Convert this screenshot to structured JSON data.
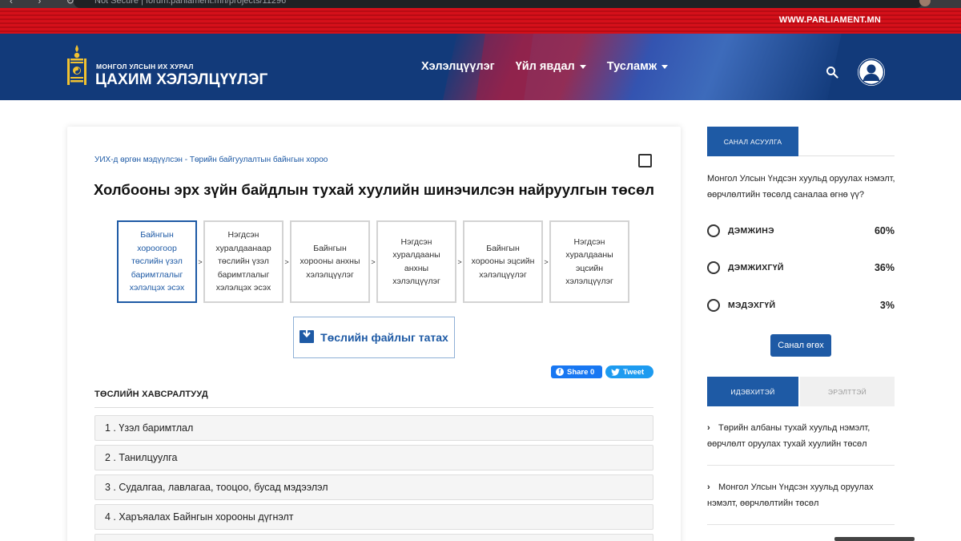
{
  "browser": {
    "url": "Not Secure | forum.parliament.mn/projects/11296"
  },
  "topbar": {
    "site_link": "WWW.PARLIAMENT.MN"
  },
  "header": {
    "logo_subtitle": "МОНГОЛ УЛСЫН ИХ ХУРАЛ",
    "logo_title": "ЦАХИМ ХЭЛЭЛЦҮҮЛЭГ",
    "menu": [
      {
        "label": "Хэлэлцүүлэг",
        "has_dropdown": false
      },
      {
        "label": "Үйл явдал",
        "has_dropdown": true
      },
      {
        "label": "Тусламж",
        "has_dropdown": true
      }
    ]
  },
  "main": {
    "breadcrumb": "УИХ-д өргөн мэдүүлсэн - Төрийн байгуулалтын байнгын хороо",
    "title": "Холбооны эрх зүйн байдлын тухай хуулийн шинэчилсэн найруулгын төсөл",
    "steps": [
      {
        "label": "Байнгын хороогоор төслийн үзэл баримтлалыг хэлэлцэх эсэх",
        "active": true
      },
      {
        "label": "Нэгдсэн хуралдаанаар төслийн үзэл баримтлалыг хэлэлцэх эсэх",
        "active": false
      },
      {
        "label": "Байнгын хорооны анхны хэлэлцүүлэг",
        "active": false
      },
      {
        "label": "Нэгдсэн хуралдааны анхны хэлэлцүүлэг",
        "active": false
      },
      {
        "label": "Байнгын хорооны эцсийн хэлэлцүүлэг",
        "active": false
      },
      {
        "label": "Нэгдсэн хуралдааны эцсийн хэлэлцүүлэг",
        "active": false
      }
    ],
    "step_separator": ">",
    "download_label": "Төслийн файлыг татах",
    "share": {
      "facebook_label": "Share 0",
      "twitter_label": "Tweet"
    },
    "attachments_heading": "ТӨСЛИЙН ХАВСРАЛТУУД",
    "attachments": [
      "1 . Үзэл баримтлал",
      "2 . Танилцуулга",
      "3 . Судалгаа, лавлагаа, тооцоо, бусад мэдээлэл",
      "4 . Харъяалах Байнгын хорооны дүгнэлт"
    ]
  },
  "sidebar": {
    "poll_tab": "САНАЛ АСУУЛГА",
    "poll_question": "Монгол Улсын Үндсэн хуульд оруулах нэмэлт, өөрчлөлтийн төсөлд саналаа өгнө үү?",
    "poll_options": [
      {
        "label": "ДЭМЖИНЭ",
        "percent": "60%"
      },
      {
        "label": "ДЭМЖИХГҮЙ",
        "percent": "36%"
      },
      {
        "label": "МЭДЭХГҮЙ",
        "percent": "3%"
      }
    ],
    "vote_button": "Санал өгөх",
    "tabs": {
      "active": "ИДЭВХИТЭЙ",
      "inactive": "ЭРЭЛТТЭЙ"
    },
    "items": [
      "Төрийн албаны тухай хуульд нэмэлт, өөрчлөлт оруулах тухай хуулийн төсөл",
      "Монгол Улсын Үндсэн хуульд оруулах нэмэлт, өөрчлөлтийн төсөл"
    ]
  },
  "colors": {
    "brand_blue": "#1e5aa5",
    "header_blue": "#123a7a",
    "top_red": "#d5101a",
    "emblem_gold": "#f2c230"
  }
}
